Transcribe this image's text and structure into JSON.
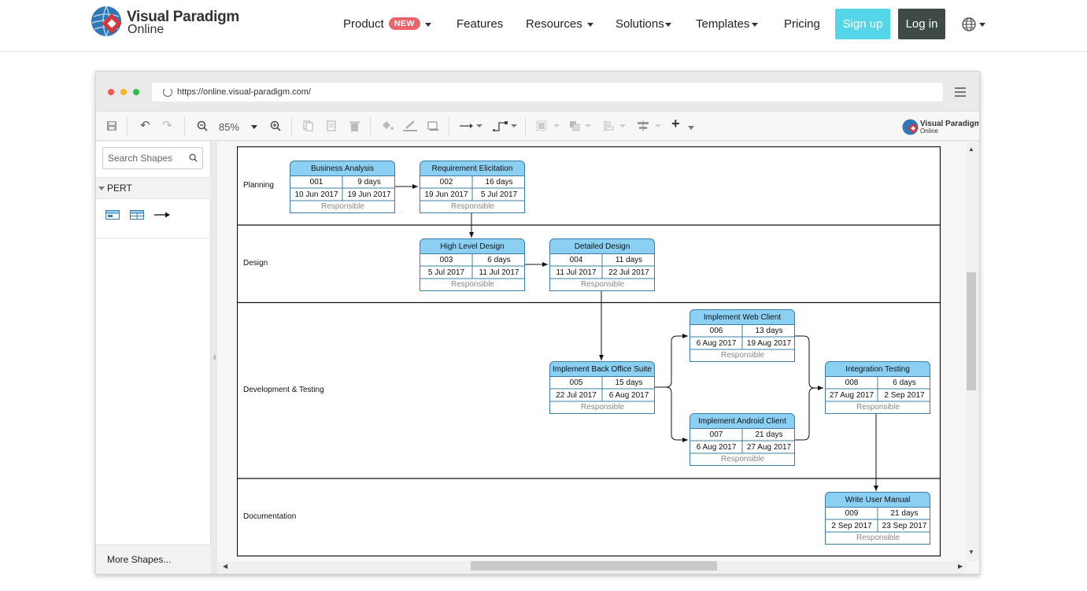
{
  "nav": {
    "logo_line1": "Visual Paradigm",
    "logo_line2": "Online",
    "items": [
      {
        "label": "Product",
        "badge": "NEW"
      },
      {
        "label": "Features"
      },
      {
        "label": "Resources"
      },
      {
        "label": "Solutions"
      },
      {
        "label": "Templates"
      },
      {
        "label": "Pricing"
      }
    ],
    "signup": "Sign up",
    "login": "Log in"
  },
  "browser": {
    "url": "https://online.visual-paradigm.com/"
  },
  "toolbar": {
    "zoom": "85%",
    "mini_logo_line1": "Visual Paradigm",
    "mini_logo_line2": "Online"
  },
  "sidebar": {
    "search_placeholder": "Search Shapes",
    "category": "PERT",
    "more_shapes": "More Shapes..."
  },
  "lanes": [
    "Planning",
    "Design",
    "Development & Testing",
    "Documentation"
  ],
  "tasks": [
    {
      "name": "Business Analysis",
      "id": "001",
      "duration": "9 days",
      "start": "10 Jun 2017",
      "end": "19 Jun 2017",
      "responsible": "Responsible"
    },
    {
      "name": "Requirement Elicitation",
      "id": "002",
      "duration": "16 days",
      "start": "19 Jun 2017",
      "end": "5 Jul 2017",
      "responsible": "Responsible"
    },
    {
      "name": "High Level Design",
      "id": "003",
      "duration": "6 days",
      "start": "5 Jul 2017",
      "end": "11 Jul 2017",
      "responsible": "Responsible"
    },
    {
      "name": "Detailed Design",
      "id": "004",
      "duration": "11 days",
      "start": "11 Jul 2017",
      "end": "22 Jul 2017",
      "responsible": "Responsible"
    },
    {
      "name": "Implement Web Client",
      "id": "006",
      "duration": "13 days",
      "start": "6 Aug 2017",
      "end": "19 Aug 2017",
      "responsible": "Responsible"
    },
    {
      "name": "Implement Back Office Suite",
      "id": "005",
      "duration": "15 days",
      "start": "22 Jul 2017",
      "end": "6 Aug 2017",
      "responsible": "Responsible"
    },
    {
      "name": "Integration Testing",
      "id": "008",
      "duration": "6 days",
      "start": "27 Aug 2017",
      "end": "2 Sep 2017",
      "responsible": "Responsible"
    },
    {
      "name": "Implement Android Client",
      "id": "007",
      "duration": "21 days",
      "start": "6 Aug 2017",
      "end": "27 Aug 2017",
      "responsible": "Responsible"
    },
    {
      "name": "Write User Manual",
      "id": "009",
      "duration": "21 days",
      "start": "2 Sep 2017",
      "end": "23 Sep 2017",
      "responsible": "Responsible"
    }
  ],
  "colors": {
    "node_header": "#8bd0f3",
    "node_border": "#3d7ca3",
    "signup": "#55d6e8",
    "login": "#3e4a47",
    "new_badge": "#e9646c"
  }
}
